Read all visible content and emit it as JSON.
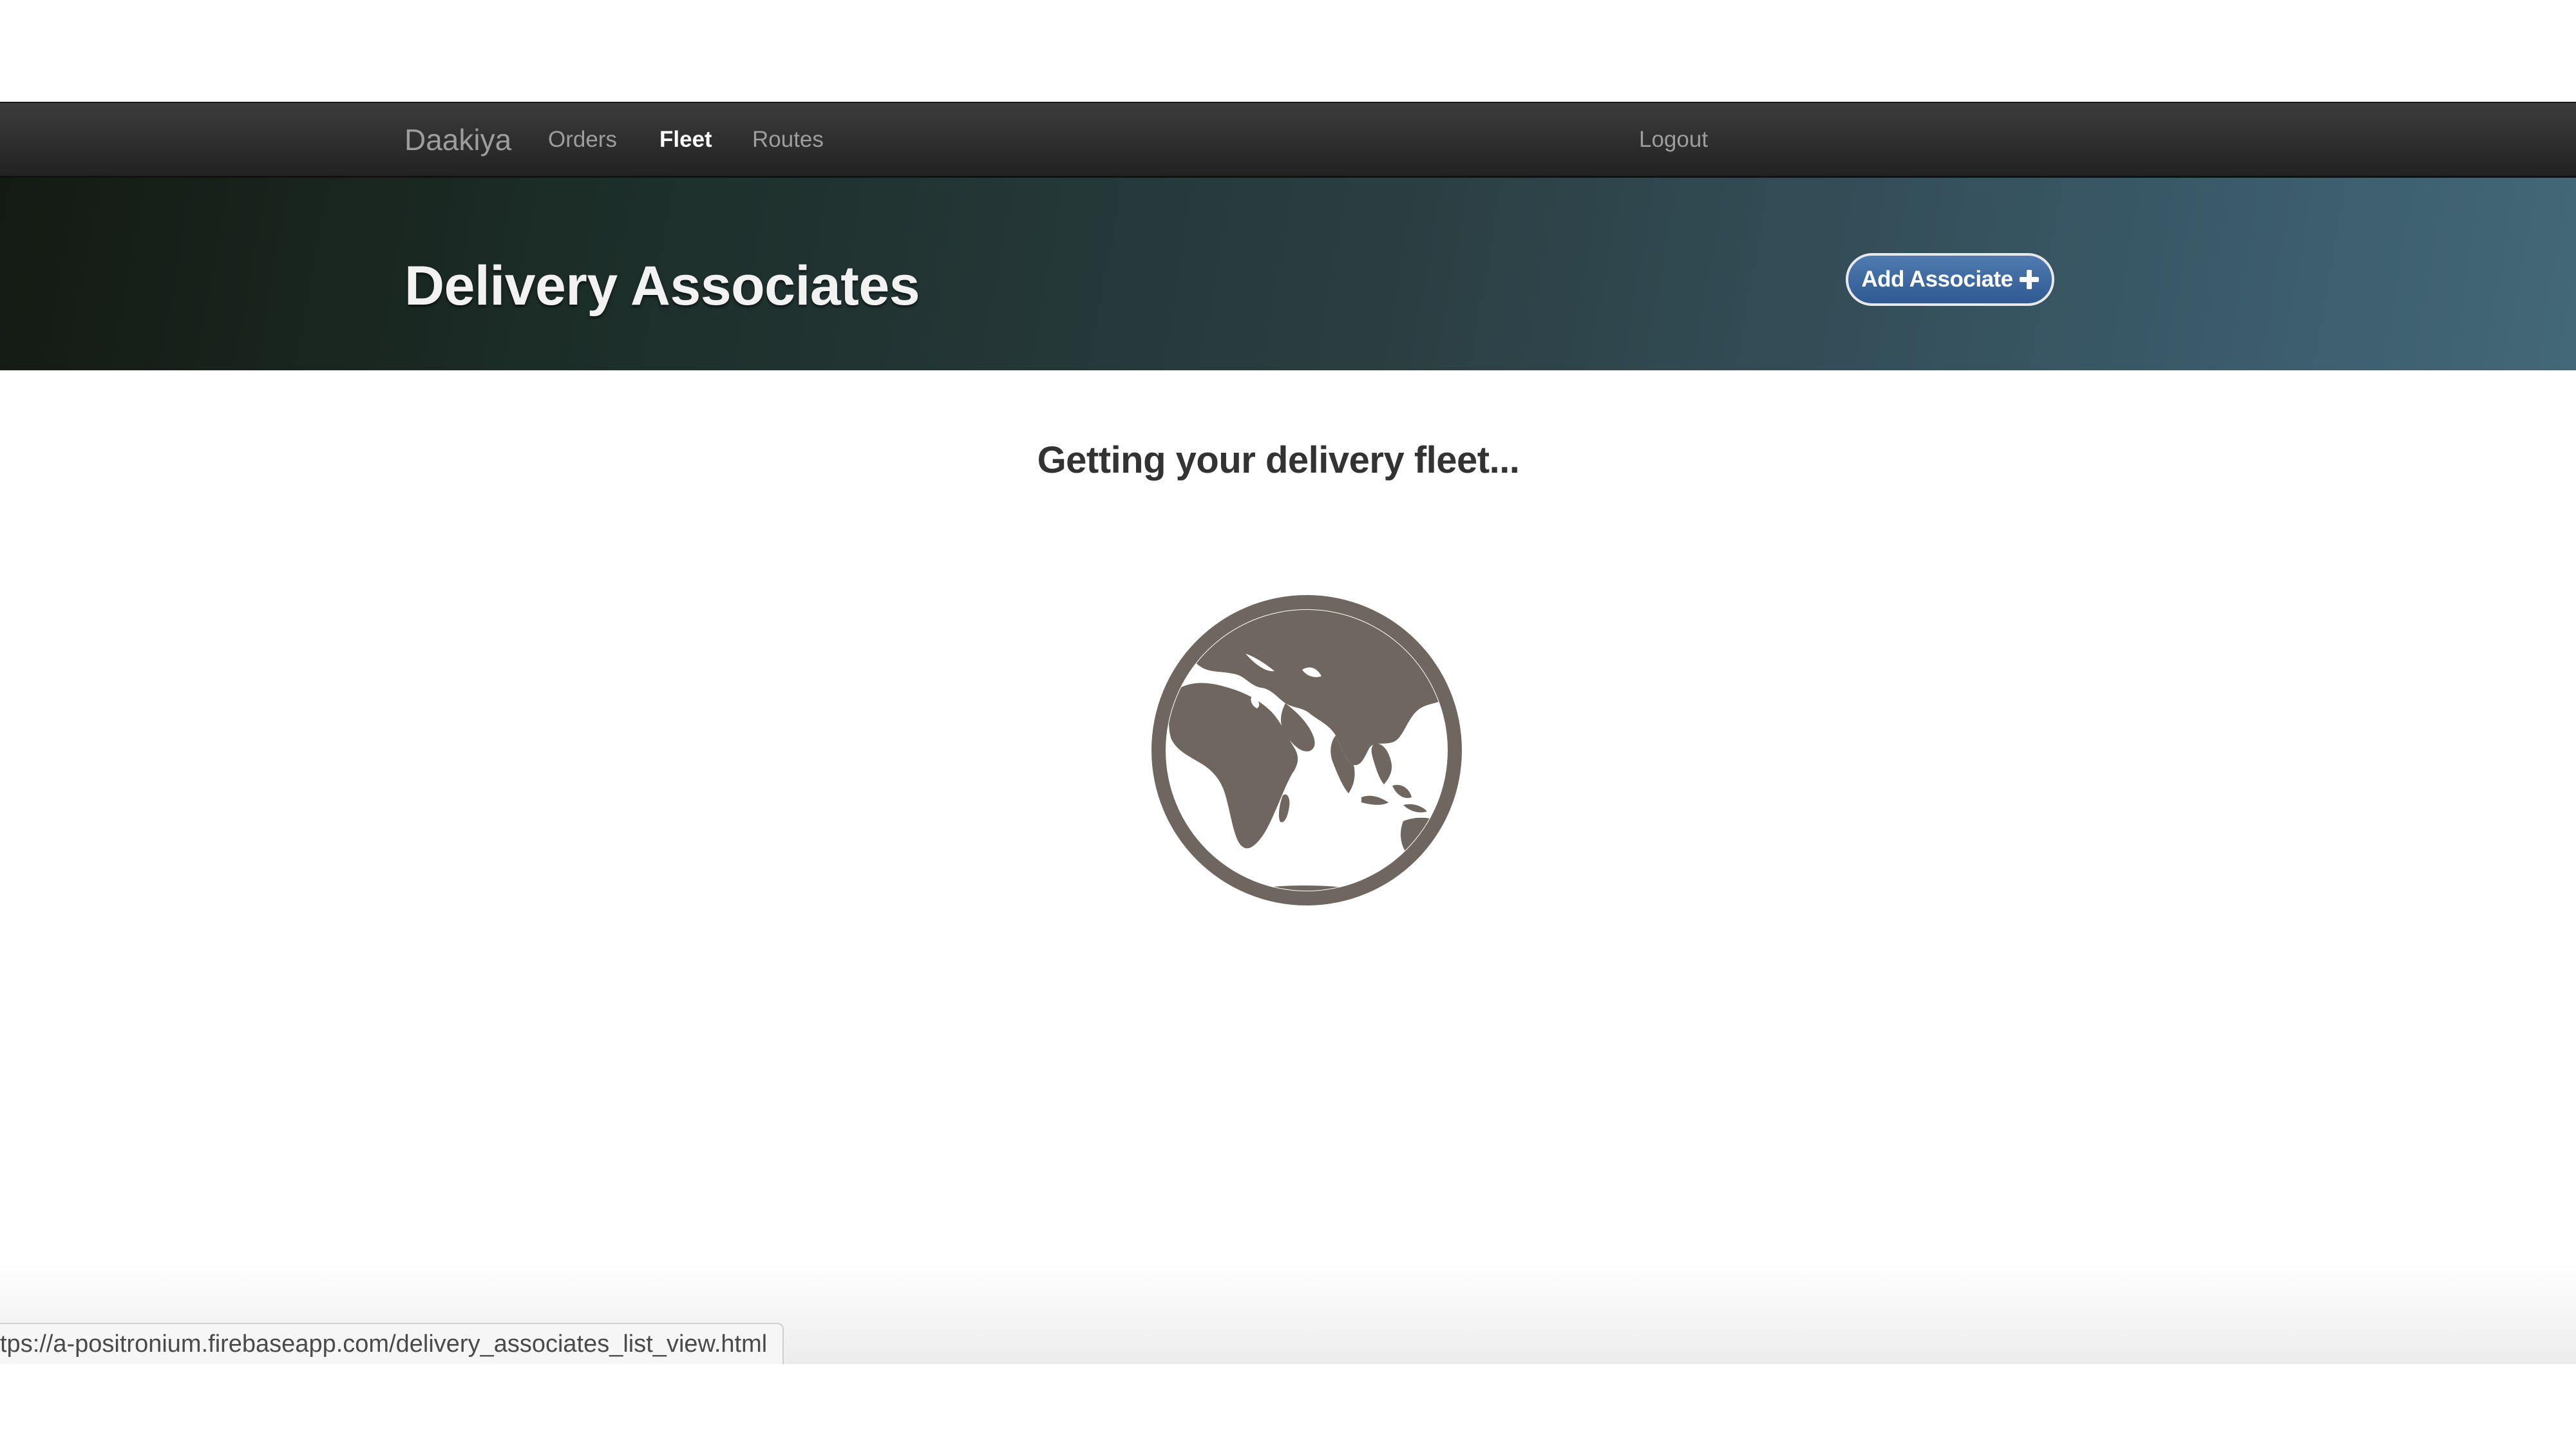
{
  "navbar": {
    "brand": "Daakiya",
    "items": [
      {
        "label": "Orders",
        "active": false
      },
      {
        "label": "Fleet",
        "active": true
      },
      {
        "label": "Routes",
        "active": false
      }
    ],
    "logout_label": "Logout"
  },
  "header": {
    "title": "Delivery Associates",
    "add_button_label": "Add Associate",
    "add_button_icon": "plus-icon"
  },
  "main": {
    "loading_text": "Getting your delivery fleet...",
    "loading_icon": "globe-icon"
  },
  "status_bar": {
    "url": "tps://a-positronium.firebaseapp.com/delivery_associates_list_view.html"
  },
  "colors": {
    "navbar_bg": "#2b2b2b",
    "button_blue": "#3a669f",
    "globe": "#6f6660"
  }
}
